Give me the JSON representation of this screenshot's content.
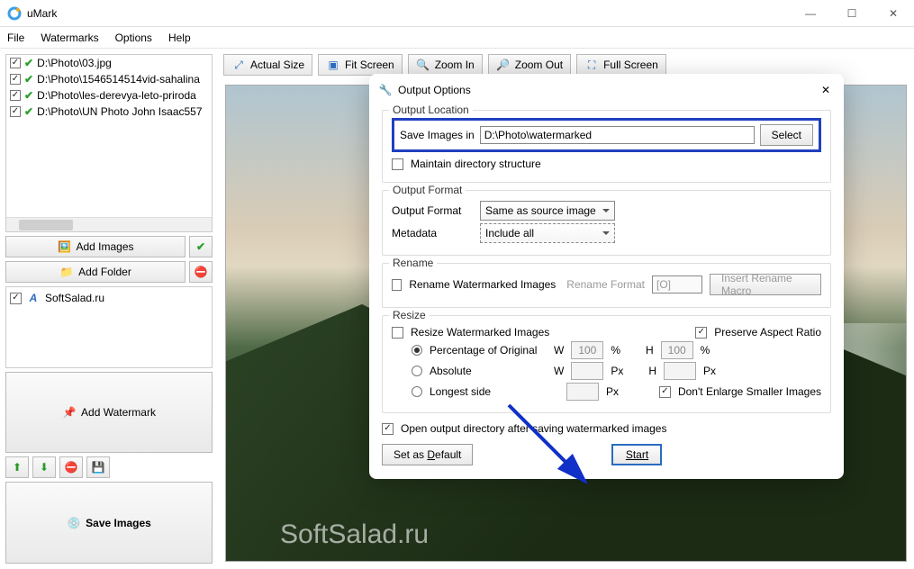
{
  "window": {
    "title": "uMark"
  },
  "menu": {
    "file": "File",
    "watermarks": "Watermarks",
    "options": "Options",
    "help": "Help"
  },
  "files": {
    "items": [
      {
        "label": "D:\\Photo\\03.jpg"
      },
      {
        "label": "D:\\Photo\\1546514514vid-sahalina"
      },
      {
        "label": "D:\\Photo\\les-derevya-leto-priroda"
      },
      {
        "label": "D:\\Photo\\UN Photo John Isaac557"
      }
    ]
  },
  "left_buttons": {
    "add_images": "Add Images",
    "add_folder": "Add Folder",
    "add_watermark": "Add Watermark",
    "save_images": "Save Images"
  },
  "watermark_list": {
    "item0": "SoftSalad.ru"
  },
  "toolbar": {
    "actual_size": "Actual Size",
    "fit_screen": "Fit Screen",
    "zoom_in": "Zoom In",
    "zoom_out": "Zoom Out",
    "full_screen": "Full Screen"
  },
  "canvas": {
    "wm_text": "SoftSalad.ru"
  },
  "dialog": {
    "title": "Output Options",
    "close": "✕",
    "output_location": {
      "legend": "Output Location",
      "save_in_label": "Save Images in",
      "path": "D:\\Photo\\watermarked",
      "select": "Select",
      "maintain": "Maintain directory structure"
    },
    "output_format": {
      "legend": "Output Format",
      "format_label": "Output Format",
      "format_value": "Same as source image",
      "metadata_label": "Metadata",
      "metadata_value": "Include all"
    },
    "rename": {
      "legend": "Rename",
      "rename_chk": "Rename Watermarked Images",
      "format_label": "Rename Format",
      "format_value": "[O]",
      "insert_macro": "Insert Rename Macro"
    },
    "resize": {
      "legend": "Resize",
      "resize_chk": "Resize Watermarked Images",
      "preserve": "Preserve Aspect Ratio",
      "pct_label": "Percentage of Original",
      "abs_label": "Absolute",
      "longest_label": "Longest side",
      "w": "W",
      "h": "H",
      "px": "Px",
      "pct": "%",
      "w_val": "100",
      "h_val": "100",
      "no_enlarge": "Don't Enlarge Smaller Images"
    },
    "open_output": "Open output directory after saving watermarked images",
    "set_default": "Set as Default",
    "start": "Start"
  }
}
